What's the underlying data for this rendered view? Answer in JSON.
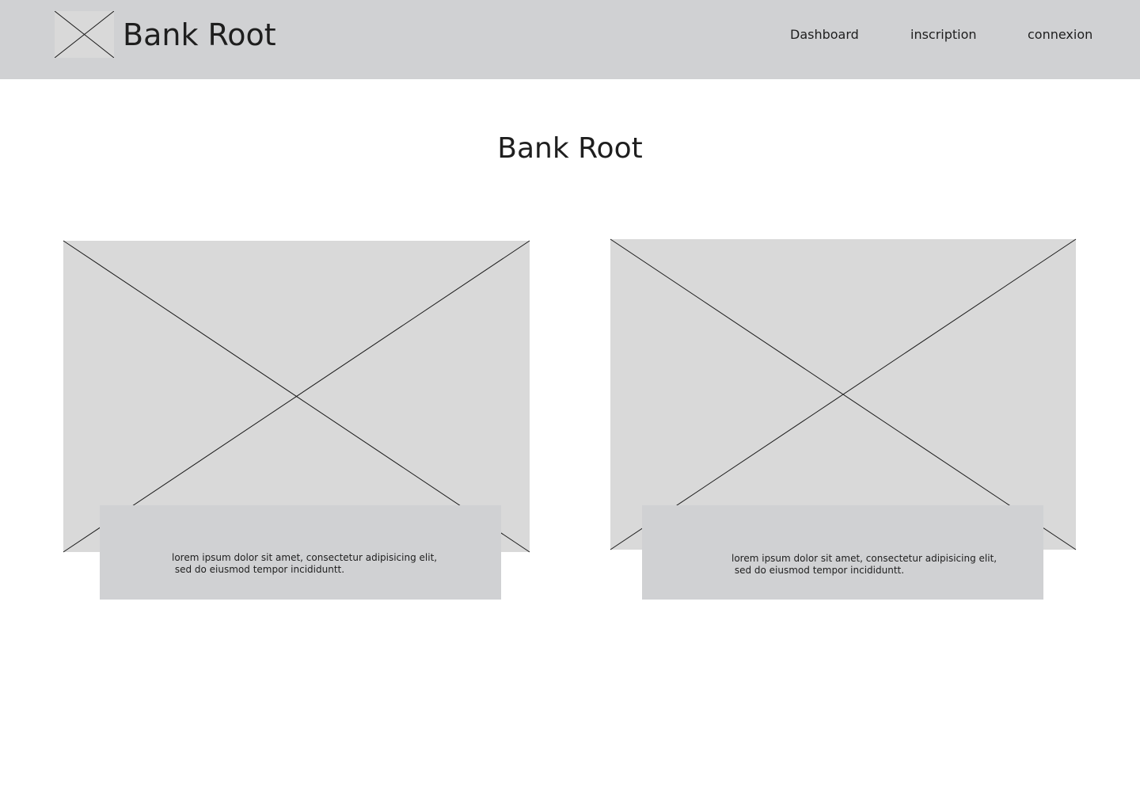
{
  "header": {
    "brand": "Bank Root",
    "logo_icon": "image-placeholder-icon",
    "nav": {
      "dashboard": "Dashboard",
      "inscription": "inscription",
      "connexion": "connexion"
    },
    "background": "#d0d1d3"
  },
  "main": {
    "title": "Bank Root",
    "cards": [
      {
        "image_icon": "image-placeholder-icon",
        "caption_line1": "lorem ipsum dolor sit amet, consectetur adipisicing elit,",
        "caption_line2": " sed do eiusmod tempor incididuntt."
      },
      {
        "image_icon": "image-placeholder-icon",
        "caption_line1": "lorem ipsum dolor sit amet, consectetur adipisicing elit,",
        "caption_line2": " sed do eiusmod tempor incididuntt."
      }
    ]
  },
  "colors": {
    "placeholder_fill": "#d9d9d9",
    "caption_fill": "#d0d1d3",
    "text": "#1e1e1e"
  }
}
